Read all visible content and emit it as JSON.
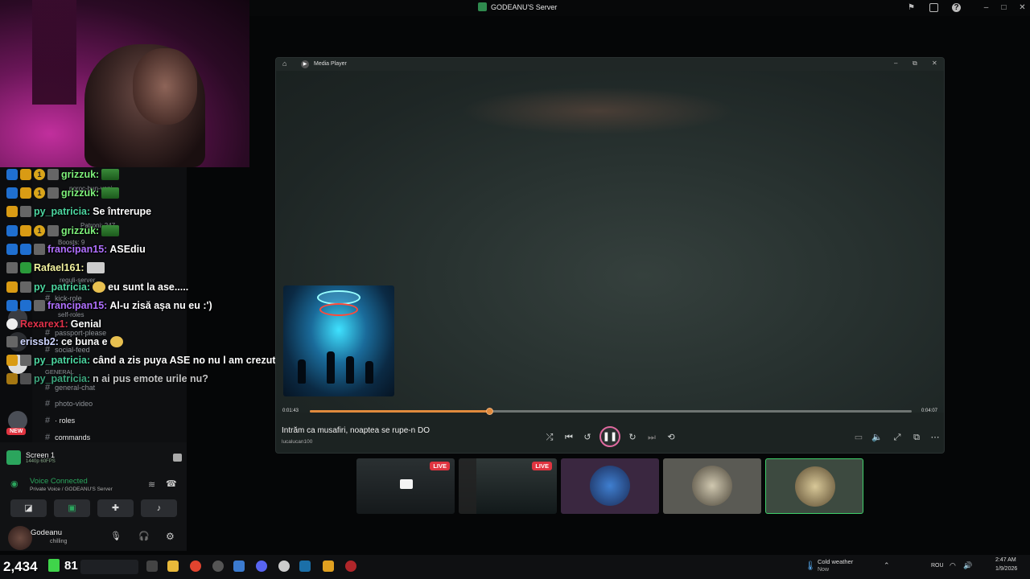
{
  "window": {
    "server_title": "GODEANU'S Server"
  },
  "player": {
    "title": "Media Player",
    "track_title": "Intrăm ca musafiri, noaptea se rupe-n DO",
    "artist": "lucalucan100",
    "elapsed": "0:01:43",
    "duration": "0:04:07",
    "progress": 0.298,
    "accent": "#e08a3d"
  },
  "chat": [
    {
      "user": "grizzuk:",
      "text": "",
      "color": "#7df07a",
      "emote": true
    },
    {
      "user": "grizzuk:",
      "text": "",
      "color": "#7df07a",
      "emote": true
    },
    {
      "user": "py_patricia:",
      "text": "Se întrerupe",
      "color": "#4cd6a0"
    },
    {
      "user": "grizzuk:",
      "text": "",
      "color": "#7df07a",
      "emote": true
    },
    {
      "user": "francipan15:",
      "text": "ASEdiu",
      "color": "#b070ff"
    },
    {
      "user": "Rafael161:",
      "text": "",
      "color": "#f4f4a0",
      "emote": true
    },
    {
      "user": "py_patricia:",
      "text": "eu sunt la ase.....",
      "color": "#4cd6a0"
    },
    {
      "user": "francipan15:",
      "text": "Al-u zisă așa nu eu :')",
      "color": "#b070ff"
    },
    {
      "user": "Rexarex1:",
      "text": "Genial",
      "color": "#e0324a"
    },
    {
      "user": "erissb2:",
      "text": "ce buna e",
      "color": "#cfd6ff"
    },
    {
      "user": "py_patricia:",
      "text": "când a zis puya ASE no nu l am crezut",
      "color": "#4cd6a0"
    },
    {
      "user": "py_patricia:",
      "text": "n ai pus emote urile nu?",
      "color": "#4cd6a0"
    }
  ],
  "channels": [
    {
      "label": "noroc-bun-veni..."
    },
    {
      "label": "Patroni: 247"
    },
    {
      "label": "Boosts: 9"
    },
    {
      "label": "reguli-server"
    },
    {
      "label": "kick-role"
    },
    {
      "label": "self-roles"
    },
    {
      "label": "passport-please"
    },
    {
      "label": "social-feed"
    },
    {
      "label": "GENERAL"
    },
    {
      "label": "general-chat"
    },
    {
      "label": "photo-video"
    },
    {
      "label": "· roles"
    },
    {
      "label": "commands"
    }
  ],
  "voice": {
    "screen_label": "Screen 1",
    "screen_quality": "1440p 60FPS",
    "status": "Voice Connected",
    "location": "Private Voice / GODEANU'S Server",
    "username": "Godeanu",
    "user_status": "chilling"
  },
  "taskbar": {
    "counter_left": "2,434",
    "counter_right": "81",
    "weather_title": "Cold weather",
    "weather_sub": "Now",
    "lang": "ROU",
    "time": "2:47 AM",
    "date": "1/9/2026"
  },
  "thumbs": [
    {
      "live": "LIVE"
    },
    {
      "live": "LIVE"
    }
  ],
  "badges": {
    "new": "NEW"
  }
}
